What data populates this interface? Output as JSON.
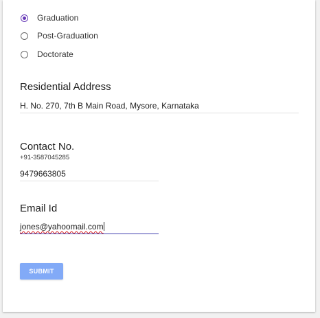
{
  "degree_options": [
    {
      "label": "Graduation",
      "checked": true
    },
    {
      "label": "Post-Graduation",
      "checked": false
    },
    {
      "label": "Doctorate",
      "checked": false
    }
  ],
  "residential": {
    "title": "Residential Address",
    "value": "H. No. 270, 7th B Main Road, Mysore, Karnataka"
  },
  "contact": {
    "title": "Contact No.",
    "helper": "+91-3587045285",
    "value": "9479663805"
  },
  "email": {
    "title": "Email Id",
    "value": "jones@yahoomail.com"
  },
  "submit_label": "SUBMIT",
  "colors": {
    "radio_accent": "#673ab7",
    "submit_bg": "#82aaf7",
    "active_underline": "#3f3dae"
  }
}
